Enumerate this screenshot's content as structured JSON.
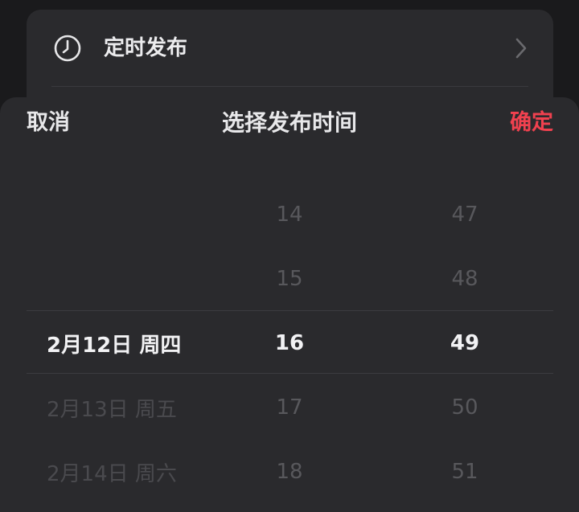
{
  "card": {
    "schedule_label": "定时发布"
  },
  "picker": {
    "cancel_label": "取消",
    "title": "选择发布时间",
    "confirm_label": "确定",
    "accent_color": "#f0414f",
    "date_column": [
      {
        "label": "",
        "state": "empty"
      },
      {
        "label": "",
        "state": "empty"
      },
      {
        "label": "2月12日 周四",
        "state": "selected"
      },
      {
        "label": "2月13日 周五",
        "state": "faded"
      },
      {
        "label": "2月14日 周六",
        "state": "faded"
      }
    ],
    "hour_column": [
      {
        "label": "14",
        "state": "faded"
      },
      {
        "label": "15",
        "state": "faded"
      },
      {
        "label": "16",
        "state": "selected"
      },
      {
        "label": "17",
        "state": "faded"
      },
      {
        "label": "18",
        "state": "faded"
      }
    ],
    "minute_column": [
      {
        "label": "47",
        "state": "faded"
      },
      {
        "label": "48",
        "state": "faded"
      },
      {
        "label": "49",
        "state": "selected"
      },
      {
        "label": "50",
        "state": "faded"
      },
      {
        "label": "51",
        "state": "faded"
      }
    ]
  },
  "icons": {
    "schedule": "clock-icon",
    "disclosure": "chevron-right-icon"
  }
}
